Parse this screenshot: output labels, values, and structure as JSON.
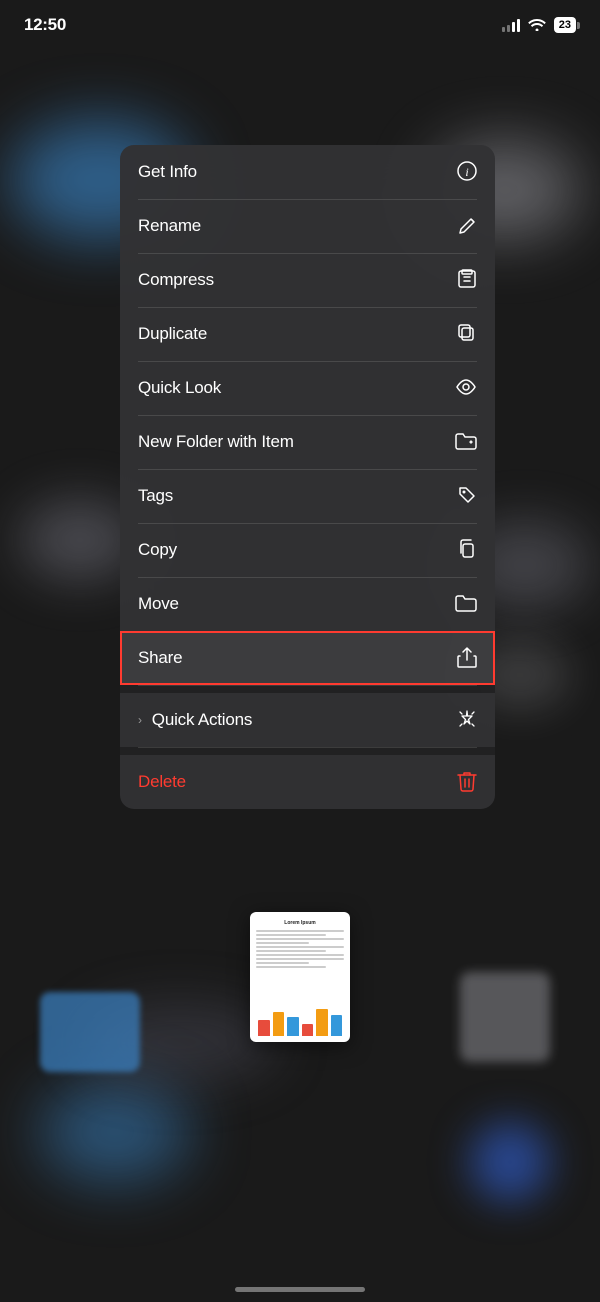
{
  "statusBar": {
    "time": "12:50",
    "battery": "23"
  },
  "contextMenu": {
    "items": [
      {
        "id": "get-info",
        "label": "Get Info",
        "icon": "ℹ",
        "highlighted": false,
        "delete": false,
        "hasChevron": false
      },
      {
        "id": "rename",
        "label": "Rename",
        "icon": "✏",
        "highlighted": false,
        "delete": false,
        "hasChevron": false
      },
      {
        "id": "compress",
        "label": "Compress",
        "icon": "🗃",
        "highlighted": false,
        "delete": false,
        "hasChevron": false
      },
      {
        "id": "duplicate",
        "label": "Duplicate",
        "icon": "⊕",
        "highlighted": false,
        "delete": false,
        "hasChevron": false
      },
      {
        "id": "quick-look",
        "label": "Quick Look",
        "icon": "👁",
        "highlighted": false,
        "delete": false,
        "hasChevron": false
      },
      {
        "id": "new-folder",
        "label": "New Folder with Item",
        "icon": "📁",
        "highlighted": false,
        "delete": false,
        "hasChevron": false
      },
      {
        "id": "tags",
        "label": "Tags",
        "icon": "🏷",
        "highlighted": false,
        "delete": false,
        "hasChevron": false
      },
      {
        "id": "copy",
        "label": "Copy",
        "icon": "📄",
        "highlighted": false,
        "delete": false,
        "hasChevron": false
      },
      {
        "id": "move",
        "label": "Move",
        "icon": "📂",
        "highlighted": false,
        "delete": false,
        "hasChevron": false
      },
      {
        "id": "share",
        "label": "Share",
        "icon": "⬆",
        "highlighted": true,
        "delete": false,
        "hasChevron": false
      }
    ],
    "quickActions": {
      "label": "Quick Actions",
      "icon": "✦",
      "hasChevron": true
    },
    "deleteItem": {
      "label": "Delete",
      "icon": "🗑"
    }
  },
  "document": {
    "title": "Lorem Ipsum",
    "chartColors": [
      "#e74c3c",
      "#f39c12",
      "#3498db"
    ]
  }
}
